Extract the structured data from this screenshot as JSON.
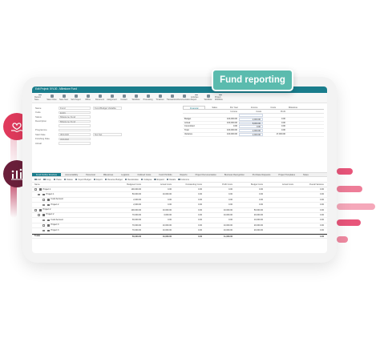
{
  "badge": {
    "label": "Fund reporting"
  },
  "app": {
    "title": "Edit Project: 5YL00 - Milestone Fund",
    "ribbon": [
      "Record Save",
      "Save Close",
      "Save New",
      "Sub Project",
      "Offline",
      "Document",
      "Assignment",
      "Contact",
      "Workflow",
      "Processing",
      "Timelines",
      "Transactions",
      "Documentation",
      "Activities Report",
      "Workflow",
      "Project Workflow"
    ]
  },
  "form": {
    "rows": [
      {
        "label": "Name",
        "value": "Fund",
        "value2": "Fund Budget Variable"
      },
      {
        "label": "Code",
        "value": "EA01",
        "value2": ""
      },
      {
        "label": "Status",
        "value": "Milestone Fund",
        "value2": ""
      },
      {
        "label": "Description",
        "value": "Milestone Fund",
        "value2": ""
      },
      {
        "label": "",
        "value": "",
        "value2": ""
      },
      {
        "label": "Programme",
        "value": "",
        "value2": ""
      },
      {
        "label": "Start Date",
        "value": "30/12/20",
        "value2": "Not Set"
      },
      {
        "label": "Finishing Date",
        "value": "31/12/22",
        "value2": ""
      },
      {
        "label": "Actual",
        "value": "",
        "value2": ""
      }
    ]
  },
  "financials": {
    "tabs": [
      "Financial",
      "Sales",
      "Per Year",
      "Income",
      "Costs",
      "Milestone"
    ],
    "columns": [
      "",
      "Income",
      "Costs",
      "Profit"
    ],
    "rows": [
      {
        "label": "",
        "income": "",
        "costs": "",
        "profit": ""
      },
      {
        "label": "Budget",
        "income": "100,000.00",
        "costs": "2,000.00",
        "profit": "0.00"
      },
      {
        "label": "Actual",
        "income": "100,000.00",
        "costs": "8,000.00",
        "profit": "0.00"
      },
      {
        "label": "Committed",
        "income": "0.00",
        "costs": "0.00",
        "profit": "0.00"
      },
      {
        "label": "Total",
        "income": "100,000.00",
        "costs": "2,000.00",
        "profit": "0.00"
      },
      {
        "label": "Variance",
        "income": "100,000.00",
        "costs": "2,000.00",
        "profit": "17,000.00"
      }
    ]
  },
  "lower": {
    "tabs": [
      "Fund Outline Structure",
      "Accountability",
      "Personnel",
      "Milestones",
      "Logistics",
      "Outlined Costs",
      "Fund Portfolio",
      "Reports",
      "Project Documentation",
      "Business Recognition",
      "Purchase Requests",
      "Project Templates",
      "Notes"
    ],
    "toolbar": [
      "Add",
      "Copy",
      "Paste",
      "Delete",
      "Import Budget",
      "Export",
      "Reverse Budget",
      "Recalculate",
      "Collapse",
      "Expand",
      "Details",
      "Columns"
    ],
    "columns": [
      "Name",
      "Budgeted Costs",
      "Actual Costs",
      "Outstanding Costs",
      "Profit Costs",
      "Budget Costs",
      "Actual Costs",
      "Overall Variance"
    ],
    "rows": [
      {
        "name": "Project 1",
        "c": [
          "100,000.00",
          "0.00",
          "0.00",
          "0.00",
          "0.00",
          "",
          "0.00"
        ]
      },
      {
        "name": "Project 1",
        "c": [
          "50,000.00",
          "10,000.00",
          "0.00",
          "0.00",
          "0.00",
          "",
          "0.00"
        ]
      },
      {
        "name": "Fund Account",
        "c": [
          "2,000.00",
          "0.00",
          "0.00",
          "0.00",
          "0.00",
          "",
          "0.00"
        ]
      },
      {
        "name": "Project 2",
        "c": [
          "2,000.00",
          "0.00",
          "0.00",
          "0.00",
          "0.00",
          "",
          "0.00"
        ]
      },
      {
        "name": "Project 2",
        "c": [
          "100,000.00",
          "10,000.00",
          "0.00",
          "10,000.00",
          "50,000.00",
          "",
          "0.00"
        ]
      },
      {
        "name": "Project 2",
        "c": [
          "70,000.00",
          "3,000.00",
          "0.00",
          "10,000.00",
          "20,000.00",
          "",
          "0.00"
        ]
      },
      {
        "name": "Fund Account",
        "c": [
          "30,000.00",
          "0.00",
          "0.00",
          "0.00",
          "10,000.00",
          "",
          "0.00"
        ]
      },
      {
        "name": "Project 3",
        "c": [
          "70,000.00",
          "10,000.00",
          "0.00",
          "10,000.00",
          "20,000.00",
          "",
          "0.00"
        ]
      },
      {
        "name": "Project 3",
        "c": [
          "70,000.00",
          "10,000.00",
          "0.00",
          "10,000.00",
          "20,000.00",
          "",
          "0.00"
        ]
      },
      {
        "name": "Totals",
        "c": [
          "50,000.00",
          "10,000.00",
          "0.00",
          "11,000.00",
          "",
          "",
          "0.00"
        ]
      }
    ]
  },
  "colors": {
    "teal": "#5bbbae",
    "brand_dark": "#1a7d8c",
    "accent_red": "#e03a5c",
    "icon_dark": "#6b1f3b"
  },
  "icons": [
    "heart-hand-icon",
    "chart-people-icon"
  ]
}
